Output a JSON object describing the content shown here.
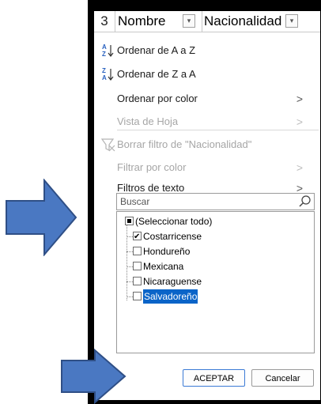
{
  "header": {
    "row_number": "3",
    "col_a": "Nombre",
    "col_b": "Nacionalidad",
    "filter_glyph": "▾"
  },
  "menu": {
    "sort_az": "Ordenar de A a Z",
    "sort_za": "Ordenar de Z a A",
    "sort_by_color": "Ordenar por color",
    "sheet_view": "Vista de Hoja",
    "clear_filter": "Borrar filtro de \"Nacionalidad\"",
    "filter_by_color": "Filtrar por color",
    "text_filters": "Filtros de texto"
  },
  "search": {
    "placeholder": "Buscar"
  },
  "list": {
    "items": [
      {
        "label": "(Seleccionar todo)",
        "state": "partial"
      },
      {
        "label": "Costarricense",
        "state": "checked"
      },
      {
        "label": "Hondureño",
        "state": "unchecked"
      },
      {
        "label": "Mexicana",
        "state": "unchecked"
      },
      {
        "label": "Nicaraguense",
        "state": "unchecked"
      },
      {
        "label": "Salvadoreño",
        "state": "unchecked",
        "highlighted": true
      }
    ]
  },
  "buttons": {
    "ok": "ACEPTAR",
    "cancel": "Cancelar"
  },
  "colors": {
    "arrow_fill": "#4a78c2",
    "arrow_stroke": "#2f4f86",
    "selection": "#0a64c8"
  }
}
